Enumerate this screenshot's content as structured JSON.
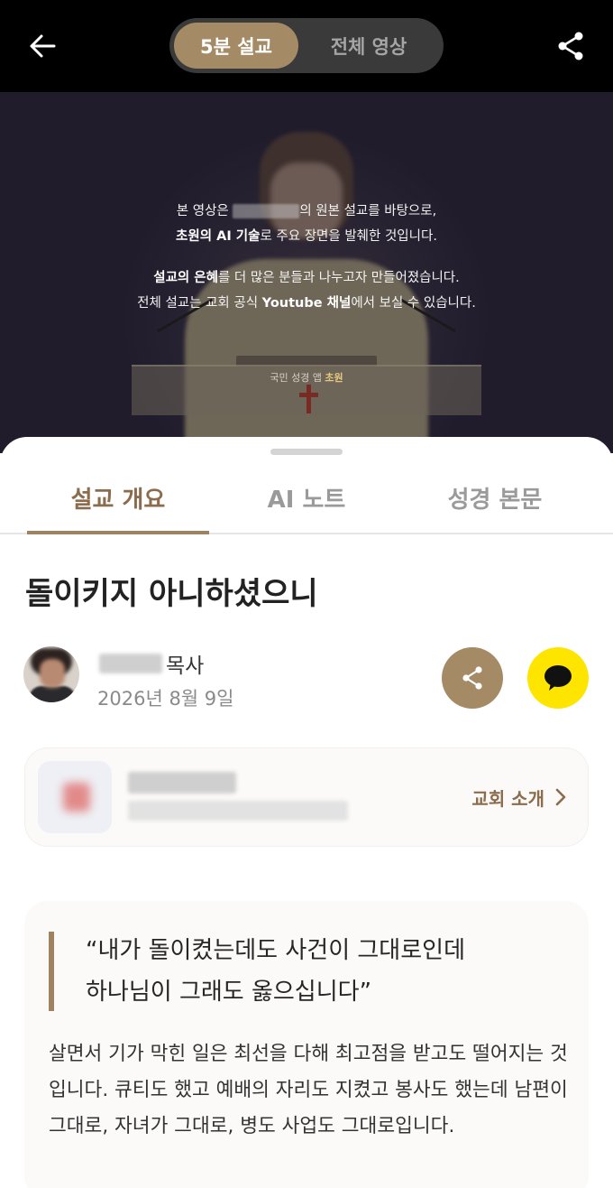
{
  "topbar": {
    "back_icon": "arrow-left-icon",
    "share_icon": "share-icon",
    "segments": [
      {
        "label": "5분 설교",
        "active": true
      },
      {
        "label": "전체 영상",
        "active": false
      }
    ]
  },
  "video": {
    "overlay": {
      "line1_before": "본 영상은",
      "line1_after": "의 원본 설교를 바탕으로,",
      "line2_bold": "초원의 AI 기술",
      "line2_rest": "로 주요 장면을 발췌한 것입니다.",
      "line3_bold": "설교의 은혜",
      "line3_rest": "를 더 많은 분들과 나누고자 만들어졌습니다.",
      "line4_before": "전체 설교는 교회 공식 ",
      "line4_bold": "Youtube 채널",
      "line4_after": "에서 보실 수 있습니다."
    },
    "watermark": {
      "prefix": "국민 성경 앱",
      "brand": "초원"
    }
  },
  "tabs": [
    {
      "label": "설교 개요",
      "active": true
    },
    {
      "label": "AI 노트",
      "active": false
    },
    {
      "label": "성경 본문",
      "active": false
    }
  ],
  "sermon": {
    "title": "돌이키지 아니하셨으니",
    "pastor_suffix": "목사",
    "date": "2026년 8월 9일"
  },
  "church": {
    "intro_label": "교회 소개"
  },
  "quote": {
    "line1": "“내가 돌이켰는데도 사건이 그대로인데",
    "line2": "하나님이 그래도 옳으십니다”",
    "body": "살면서 기가 막힌 일은 최선을 다해 최고점을 받고도 떨어지는 것입니다. 큐티도 했고 예배의 자리도 지켰고 봉사도 했는데 남편이 그대로, 자녀가 그대로, 병도 사업도 그대로입니다."
  },
  "colors": {
    "accent": "#a58a66",
    "accent_text": "#8b6c4d",
    "kakao": "#fee500"
  }
}
